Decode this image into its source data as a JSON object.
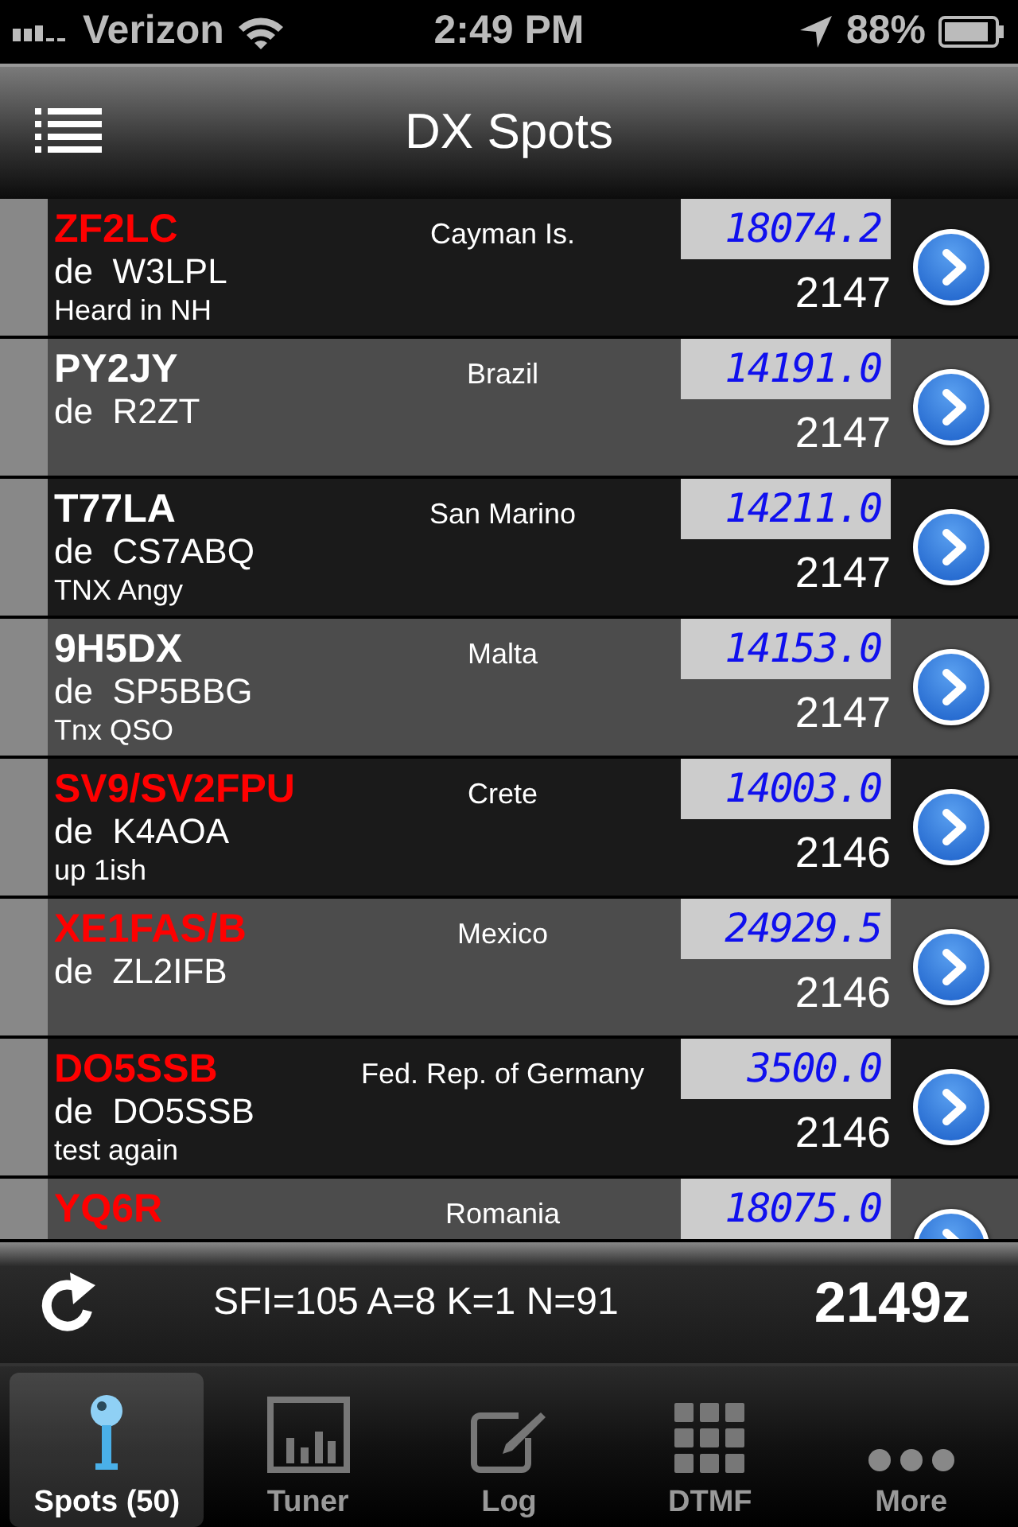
{
  "status_bar": {
    "carrier": "Verizon",
    "time": "2:49 PM",
    "battery": "88%"
  },
  "nav": {
    "title": "DX Spots"
  },
  "spots": [
    {
      "call": "ZF2LC",
      "color": "#ff0000",
      "spotter": "de  W3LPL",
      "comment": "Heard in NH",
      "country": "Cayman Is.",
      "freq": "18074.2",
      "time": "2147"
    },
    {
      "call": "PY2JY",
      "color": "#ffffff",
      "spotter": "de  R2ZT",
      "country": "Brazil",
      "freq": "14191.0",
      "time": "2147"
    },
    {
      "call": "T77LA",
      "color": "#ffffff",
      "spotter": "de  CS7ABQ",
      "comment": "TNX Angy",
      "country": "San Marino",
      "freq": "14211.0",
      "time": "2147"
    },
    {
      "call": "9H5DX",
      "color": "#ffffff",
      "spotter": "de  SP5BBG",
      "comment": "Tnx QSO",
      "country": "Malta",
      "freq": "14153.0",
      "time": "2147"
    },
    {
      "call": "SV9/SV2FPU",
      "color": "#ff0000",
      "spotter": "de  K4AOA",
      "comment": "up 1ish",
      "country": "Crete",
      "freq": "14003.0",
      "time": "2146"
    },
    {
      "call": "XE1FAS/B",
      "color": "#ff0000",
      "spotter": "de  ZL2IFB",
      "country": "Mexico",
      "freq": "24929.5",
      "time": "2146"
    },
    {
      "call": "DO5SSB",
      "color": "#ff0000",
      "spotter": "de  DO5SSB",
      "comment": "test again",
      "country": "Fed. Rep. of Germany",
      "freq": "3500.0",
      "time": "2146"
    },
    {
      "call": "YQ6R",
      "color": "#ff0000",
      "country": "Romania",
      "freq": "18075.0"
    }
  ],
  "footer": {
    "conditions": "SFI=105 A=8 K=1 N=91",
    "utc": "2149z"
  },
  "tabs": [
    {
      "label": "Spots (50)",
      "kind": "pin",
      "selected": true
    },
    {
      "label": "Tuner",
      "kind": "meter",
      "selected": false
    },
    {
      "label": "Log",
      "kind": "edit",
      "selected": false
    },
    {
      "label": "DTMF",
      "kind": "keypad",
      "selected": false
    },
    {
      "label": "More",
      "kind": "dots",
      "selected": false
    }
  ]
}
